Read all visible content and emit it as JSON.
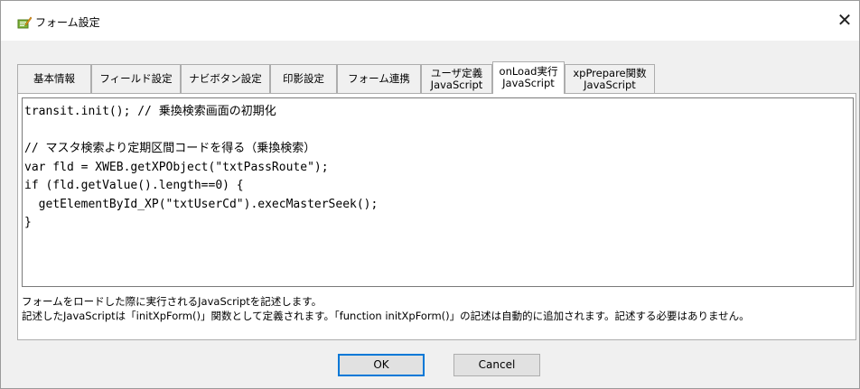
{
  "window": {
    "title": "フォーム設定",
    "close_glyph": "✕",
    "icon": "form-edit-icon"
  },
  "tabs": [
    {
      "line1": "基本情報",
      "line2": ""
    },
    {
      "line1": "フィールド設定",
      "line2": ""
    },
    {
      "line1": "ナビボタン設定",
      "line2": ""
    },
    {
      "line1": "印影設定",
      "line2": ""
    },
    {
      "line1": "フォーム連携",
      "line2": ""
    },
    {
      "line1": "ユーザ定義",
      "line2": "JavaScript"
    },
    {
      "line1": "onLoad実行",
      "line2": "JavaScript"
    },
    {
      "line1": "xpPrepare関数",
      "line2": "JavaScript"
    }
  ],
  "active_tab_index": 6,
  "editor": {
    "code": "transit.init(); // 乗換検索画面の初期化\n\n// マスタ検索より定期区間コードを得る（乗換検索）\nvar fld = XWEB.getXPObject(\"txtPassRoute\");\nif (fld.getValue().length==0) {\n  getElementById_XP(\"txtUserCd\").execMasterSeek();\n}"
  },
  "description": {
    "line1": "フォームをロードした際に実行されるJavaScriptを記述します。",
    "line2": "記述したJavaScriptは「initXpForm()」関数として定義されます。「function initXpForm()」の記述は自動的に追加されます。記述する必要はありません。"
  },
  "buttons": {
    "ok": "OK",
    "cancel": "Cancel"
  }
}
